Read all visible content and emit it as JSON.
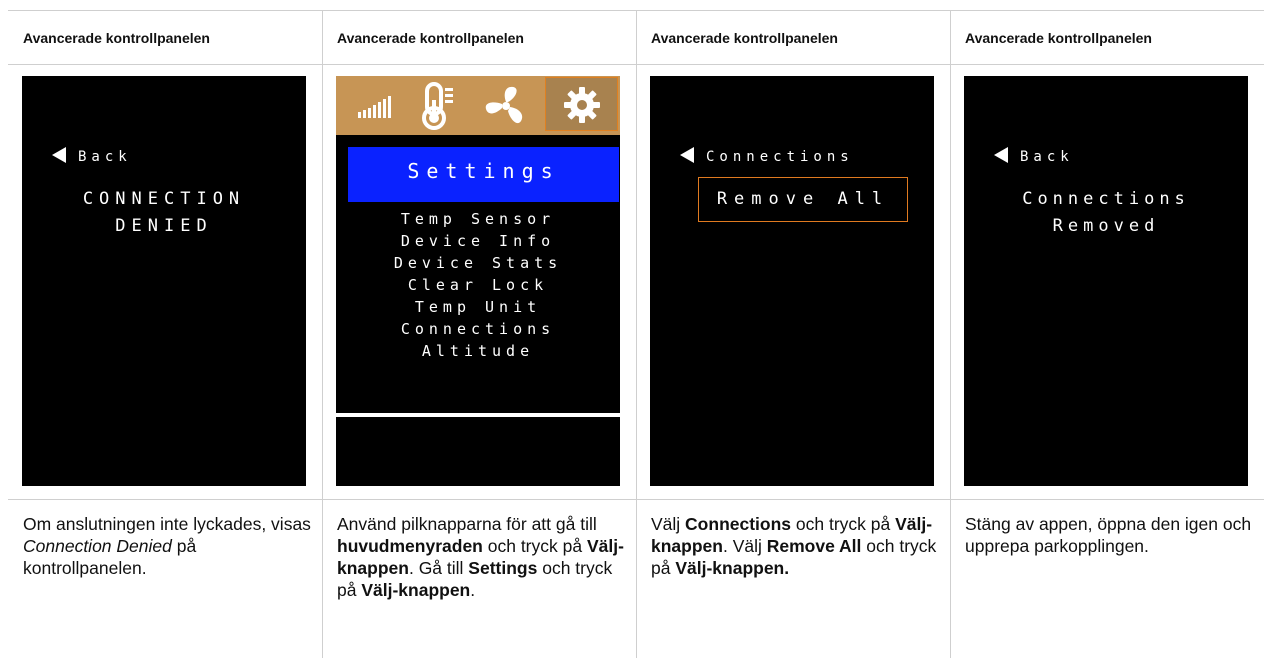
{
  "columns": [
    {
      "header": "Avancerade kontrollpanelen",
      "screen": {
        "back_label": "Back",
        "message_line1": "CONNECTION",
        "message_line2": "DENIED"
      },
      "desc": {
        "t1": "Om anslutningen inte lyckades, visas ",
        "i1": "Connection Denied",
        "t2": " på kontrollpanelen."
      }
    },
    {
      "header": "Avancerade kontrollpanelen",
      "screen": {
        "tabs": [
          "signal-icon",
          "thermometer-icon",
          "fan-icon",
          "gear-icon"
        ],
        "title": "Settings",
        "menu": [
          "Temp Sensor",
          "Device Info",
          "Device Stats",
          "Clear Lock",
          "Temp Unit",
          "Connections",
          "Altitude"
        ]
      },
      "desc": {
        "t1": "Använd pilknapparna för att gå till ",
        "b1": "huvudmenyraden",
        "t2": " och tryck på ",
        "b2": "Välj-knappen",
        "t3": ". Gå till ",
        "b3": "Settings",
        "t4": " och tryck på ",
        "b4": "Välj-knappen",
        "t5": "."
      }
    },
    {
      "header": "Avancerade kontrollpanelen",
      "screen": {
        "back_label": "Connections",
        "button_label": "Remove All"
      },
      "desc": {
        "t1": "Välj ",
        "b1": "Connections",
        "t2": " och tryck på ",
        "b2": "Välj-knappen",
        "t3": ". Välj ",
        "b3": "Remove All",
        "t4": " och tryck på ",
        "b4": "Välj-knappen."
      }
    },
    {
      "header": "Avancerade kontrollpanelen",
      "screen": {
        "back_label": "Back",
        "message_line1": "Connections",
        "message_line2": "Removed"
      },
      "desc": {
        "t1": "Stäng av appen, öppna den igen och upprepa parkopplingen."
      }
    }
  ],
  "colors": {
    "screen_bg": "#000000",
    "tab_bar": "#c79555",
    "settings_bar": "#0a22ff",
    "highlight_border": "#e07a20",
    "grid_lines": "#cfcfcf"
  }
}
